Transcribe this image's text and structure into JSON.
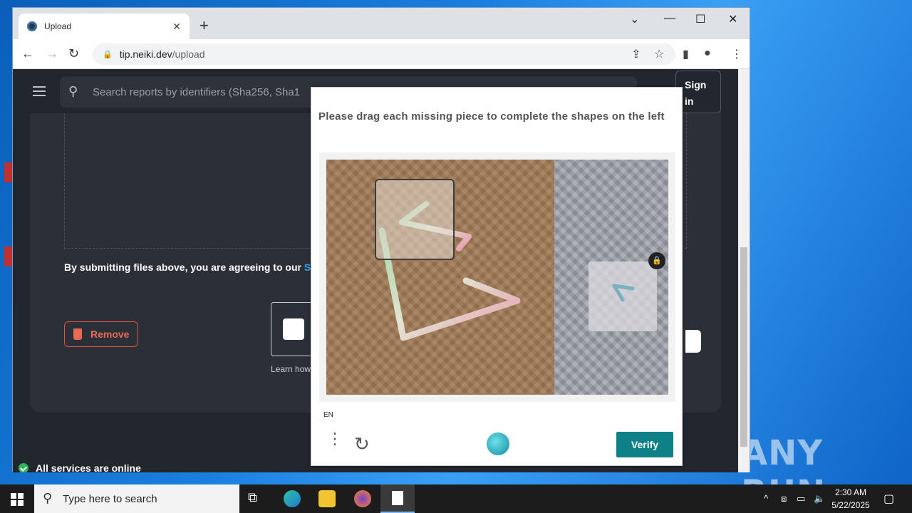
{
  "browser": {
    "tab_title": "Upload",
    "url_host": "tip.neiki.dev",
    "url_path": "/upload"
  },
  "page": {
    "search_placeholder": "Search reports by identifiers (Sha256, Sha1",
    "signin_label": "Sign in",
    "agree_text": "By submitting files above, you are agreeing to our ",
    "agree_link": "Su",
    "remove_label": "Remove",
    "learn_text": "Learn how",
    "status_text": "All services are online"
  },
  "captcha": {
    "prompt": "Please drag each missing piece to complete the shapes on the left",
    "language": "EN",
    "verify_label": "Verify"
  },
  "taskbar": {
    "search_placeholder": "Type here to search",
    "time": "2:30 AM",
    "date": "5/22/2025"
  },
  "watermark": "ANY RUN"
}
